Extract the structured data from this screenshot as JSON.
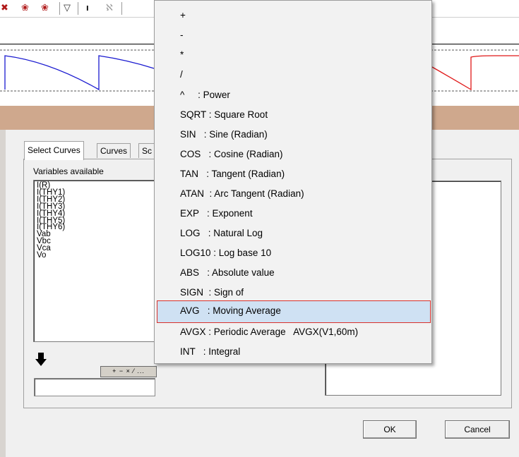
{
  "toolbar": {
    "icons": [
      "add-icon",
      "car-icon",
      "car-icon",
      "shape-icon",
      "pin-icon",
      "graph-icon"
    ],
    "glyphs": [
      "✖",
      "❀",
      "❀",
      "▽",
      "ı",
      "ℵ"
    ]
  },
  "wave_colors": {
    "left": "#1a1ad0",
    "right": "#e01818"
  },
  "menu": {
    "items": [
      {
        "label": "+"
      },
      {
        "label": "-"
      },
      {
        "label": "*"
      },
      {
        "label": "/"
      },
      {
        "label": "^     : Power"
      },
      {
        "label": "SQRT : Square Root"
      },
      {
        "label": "SIN   : Sine (Radian)"
      },
      {
        "label": "COS   : Cosine (Radian)"
      },
      {
        "label": "TAN   : Tangent (Radian)"
      },
      {
        "label": "ATAN  : Arc Tangent (Radian)"
      },
      {
        "label": "EXP   : Exponent"
      },
      {
        "label": "LOG   : Natural Log"
      },
      {
        "label": "LOG10 : Log base 10"
      },
      {
        "label": "ABS   : Absolute value"
      },
      {
        "label": "SIGN  : Sign of"
      },
      {
        "label": "AVG   : Moving Average"
      },
      {
        "label": "AVGX : Periodic Average   AVGX(V1,60m)"
      },
      {
        "label": "INT   : Integral"
      }
    ],
    "highlighted_index": 15
  },
  "dialog": {
    "tabs": [
      {
        "label": "Select Curves"
      },
      {
        "label": "Curves"
      },
      {
        "label": "Sc"
      }
    ],
    "variables_label": "Variables available",
    "variables": [
      "I(R)",
      "I(THY1)",
      "I(THY2)",
      "I(THY3)",
      "I(THY4)",
      "I(THY5)",
      "I(THY6)",
      "Vab",
      "Vbc",
      "Vca",
      "Vo"
    ],
    "operators_strip": "+ − × ⁄ ...",
    "formula_value": "",
    "ok_label": "OK",
    "cancel_label": "Cancel"
  }
}
